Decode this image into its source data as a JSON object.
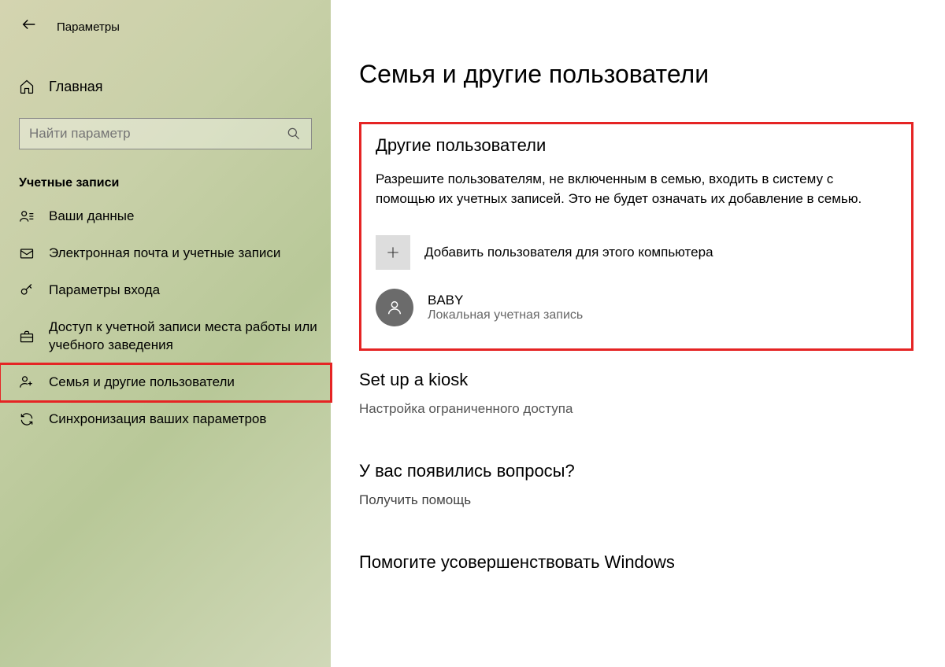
{
  "titlebar": {
    "app": "Параметры"
  },
  "sidebar": {
    "home": "Главная",
    "search_placeholder": "Найти параметр",
    "section": "Учетные записи",
    "items": [
      {
        "label": "Ваши данные"
      },
      {
        "label": "Электронная почта и учетные записи"
      },
      {
        "label": "Параметры входа"
      },
      {
        "label": "Доступ к учетной записи места работы или учебного заведения"
      },
      {
        "label": "Семья и другие пользователи"
      },
      {
        "label": "Синхронизация ваших параметров"
      }
    ]
  },
  "main": {
    "title": "Семья и другие пользователи",
    "other_users": {
      "heading": "Другие пользователи",
      "description": "Разрешите пользователям, не включенным в семью, входить в систему с помощью их учетных записей. Это не будет означать их добавление в семью.",
      "add_label": "Добавить пользователя для этого компьютера",
      "user": {
        "name": "BABY",
        "type": "Локальная учетная запись"
      }
    },
    "kiosk": {
      "heading": "Set up a kiosk",
      "sub": "Настройка ограниченного доступа"
    },
    "help": {
      "heading": "У вас появились вопросы?",
      "link": "Получить помощь"
    },
    "feedback": {
      "heading": "Помогите усовершенствовать Windows"
    }
  }
}
